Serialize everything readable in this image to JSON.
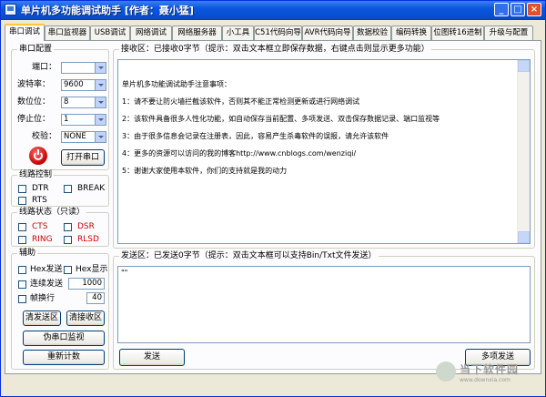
{
  "window": {
    "title": "单片机多功能调试助手 [作者：聂小猛]",
    "minimize": "_",
    "maximize": "□",
    "close": "×"
  },
  "tabs": [
    "串口调试",
    "串口监视器",
    "USB调试",
    "网络调试",
    "网络服务器",
    "小工具",
    "C51代码向导",
    "AVR代码向导",
    "数据校验",
    "编码转换",
    "位图转16进制",
    "升级与配置"
  ],
  "serial_config": {
    "title": "串口配置",
    "port_label": "端口：",
    "port_value": "",
    "baud_label": "波特率：",
    "baud_value": "9600",
    "databits_label": "数位位：",
    "databits_value": "8",
    "stopbits_label": "停止位：",
    "stopbits_value": "1",
    "parity_label": "校验：",
    "parity_value": "NONE",
    "open_button": "打开串口"
  },
  "line_control": {
    "title": "线路控制",
    "dtr": "DTR",
    "brk": "BREAK",
    "rts": "RTS"
  },
  "line_status": {
    "title": "线路状态（只读）",
    "cts": "CTS",
    "dsr": "DSR",
    "ring": "RING",
    "rlsd": "RLSD"
  },
  "aux": {
    "title": "辅助",
    "hex_send": "Hex发送",
    "hex_display": "Hex显示",
    "continuous_send": "连续发送",
    "interval_value": "1000",
    "frame_newline": "帧换行",
    "frame_value": "40",
    "clear_send": "清发送区",
    "clear_recv": "清接收区",
    "fake_monitor": "伪串口监视",
    "recount": "重新计数"
  },
  "receive": {
    "title": "接收区：已接收0字节（提示：双击文本框立即保存数据，右键点击则显示更多功能）",
    "lines": [
      "单片机多功能调试助手注意事项：",
      "1：请不要让防火墙拦截该软件，否则其不能正常检测更新或进行网络调试",
      "2：该软件具备很多人性化功能，如自动保存当前配置、多项发送、双击保存数据记录、端口监视等",
      "3：由于很多信息会记录在注册表，因此，容易产生杀毒软件的误报，请允许该软件",
      "4：更多的资源可以访问的我的博客http://www.cnblogs.com/wenziqi/",
      "5：谢谢大家使用本软件，你们的支持就是我的动力"
    ]
  },
  "send": {
    "title": "发送区：已发送0字节（提示：双击文本框可以支持Bin/Txt文件发送）",
    "text": "\"\"",
    "send_button": "发送",
    "multi_send": "多项发送"
  },
  "watermark": {
    "title": "当下软件园",
    "subtitle": "www.downxia.com"
  }
}
